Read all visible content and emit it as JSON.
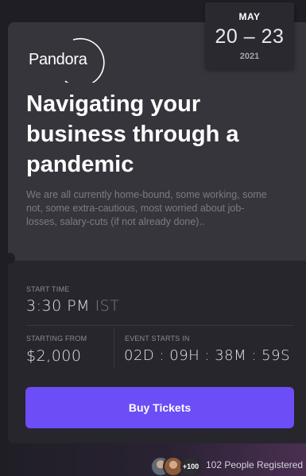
{
  "event": {
    "date": {
      "month": "MAY",
      "range": "20 – 23",
      "year": "2021"
    },
    "logo_text": "Pandora",
    "title": "Navigating your business through a pandemic",
    "description": "We are all currently home-bound, some working, some not, some extra-cautious, most worried about job-losses, salary-cuts (if not already done)..",
    "start_time_label": "START TIME",
    "start_time_value": "3:30 PM",
    "start_time_zone": "IST",
    "price_label": "STARTING FROM",
    "price_value": "$2,000",
    "countdown_label": "EVENT STARTS IN",
    "countdown_value": "02D : 09H : 38M : 59S",
    "buy_label": "Buy Tickets",
    "attendees_more": "+100",
    "registered_text": "102 People Registered"
  },
  "colors": {
    "accent": "#6c4df6",
    "card": "#36353c",
    "card_dark": "#27262c"
  }
}
